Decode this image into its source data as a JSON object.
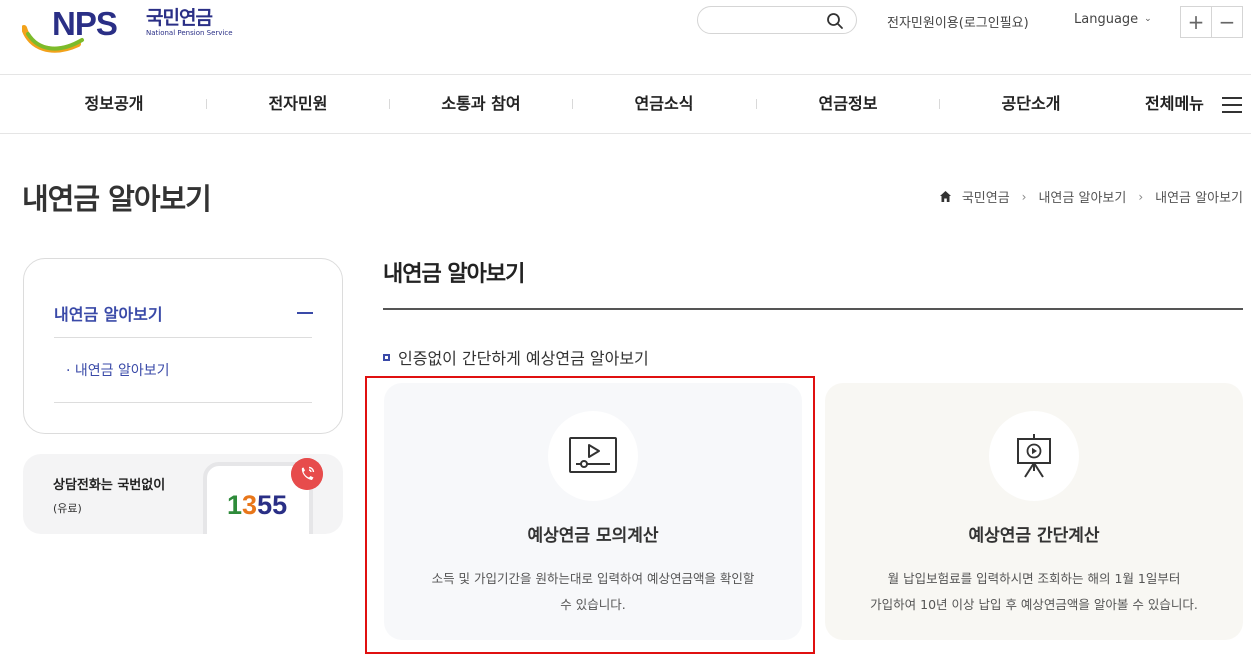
{
  "header": {
    "logo": {
      "mark": "NPS",
      "name_ko": "국민연금",
      "name_en": "National Pension Service"
    },
    "search": {
      "placeholder": "",
      "value": ""
    },
    "login_link": "전자민원이용(로그인필요)",
    "language": "Language",
    "zoom_in": "+",
    "zoom_out": "−"
  },
  "gnb": {
    "items": [
      "정보공개",
      "전자민원",
      "소통과 참여",
      "연금소식",
      "연금정보",
      "공단소개"
    ],
    "all_menu": "전체메뉴"
  },
  "page_title": "내연금 알아보기",
  "breadcrumb": [
    "국민연금",
    "내연금 알아보기",
    "내연금 알아보기"
  ],
  "lnb": {
    "head": "내연금 알아보기",
    "sub_items": [
      "· 내연금 알아보기"
    ]
  },
  "call_box": {
    "title": "상담전화는 국번없이",
    "sub": "(유료)",
    "number_digits": [
      "1",
      "3",
      "5",
      "5"
    ],
    "number_colors": [
      "#2e8b3a",
      "#e8761a",
      "#2a2f86",
      "#2a2f86"
    ]
  },
  "content": {
    "title": "내연금 알아보기",
    "bullet": "인증없이 간단하게 예상연금 알아보기",
    "cards": [
      {
        "icon": "video-play-icon",
        "title": "예상연금 모의계산",
        "desc_lines": [
          "소득 및 가입기간을 원하는대로 입력하여 예상연금액을 확인할",
          "수 있습니다."
        ]
      },
      {
        "icon": "presentation-play-icon",
        "title": "예상연금 간단계산",
        "desc_lines": [
          "월 납입보험료를 입력하시면 조회하는 해의 1월 1일부터",
          "가입하여 10년 이상 납입 후 예상연금액을 알아볼 수 있습니다."
        ]
      }
    ]
  },
  "colors": {
    "brand_navy": "#2a2f86",
    "lnb_blue": "#3a4aa8",
    "highlight_red": "#e01010"
  }
}
